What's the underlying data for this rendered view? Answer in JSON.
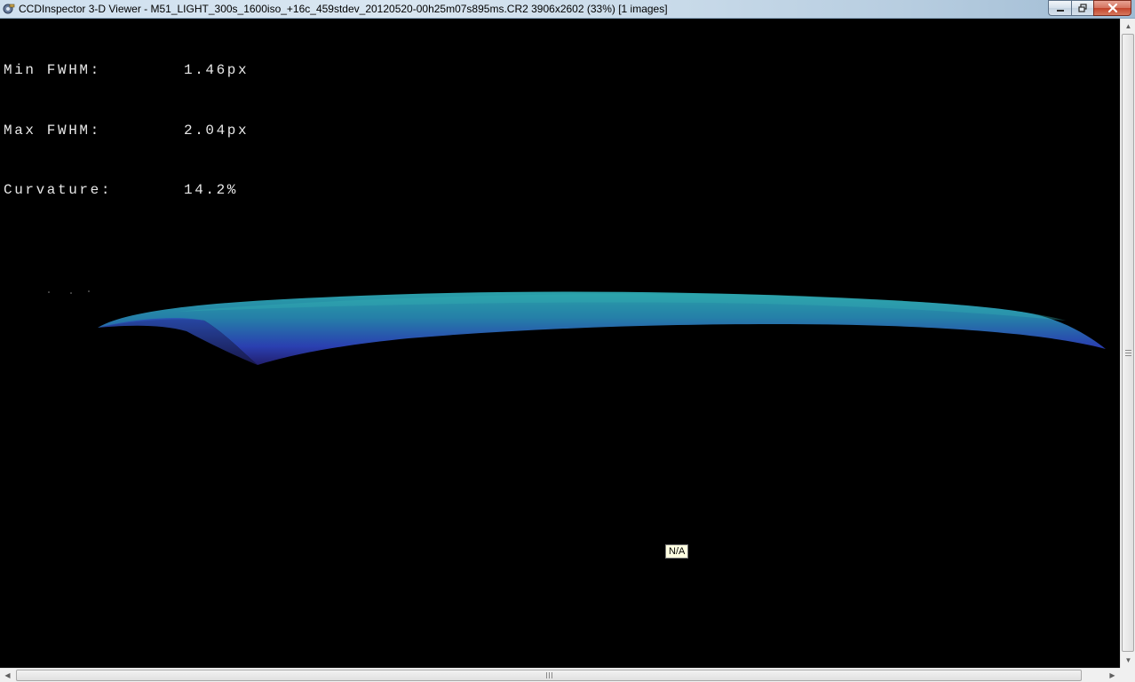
{
  "window": {
    "title": "CCDInspector 3-D Viewer - M51_LIGHT_300s_1600iso_+16c_459stdev_20120520-00h25m07s895ms.CR2 3906x2602 (33%)  [1 images]",
    "icon": "ccdinspector-app-icon",
    "controls": {
      "minimize_icon": "minimize-icon",
      "maximize_icon": "restore-icon",
      "close_icon": "close-icon"
    }
  },
  "stats": {
    "min_fwhm_label": "Min FWHM:",
    "min_fwhm_value": "1.46px",
    "max_fwhm_label": "Max FWHM:",
    "max_fwhm_value": "2.04px",
    "curvature_label": "Curvature:",
    "curvature_value": "14.2%"
  },
  "surface": {
    "description_color_low": "#2a2a9a",
    "description_color_high": "#2a9aa8"
  },
  "tooltip": {
    "text": "N/A"
  },
  "scrollbars": {
    "up_arrow": "▲",
    "down_arrow": "▼",
    "left_arrow": "◀",
    "right_arrow": "▶"
  },
  "colors": {
    "background": "#000000",
    "stats_text": "#e8e8e8",
    "tooltip_bg": "#ffffe1"
  }
}
